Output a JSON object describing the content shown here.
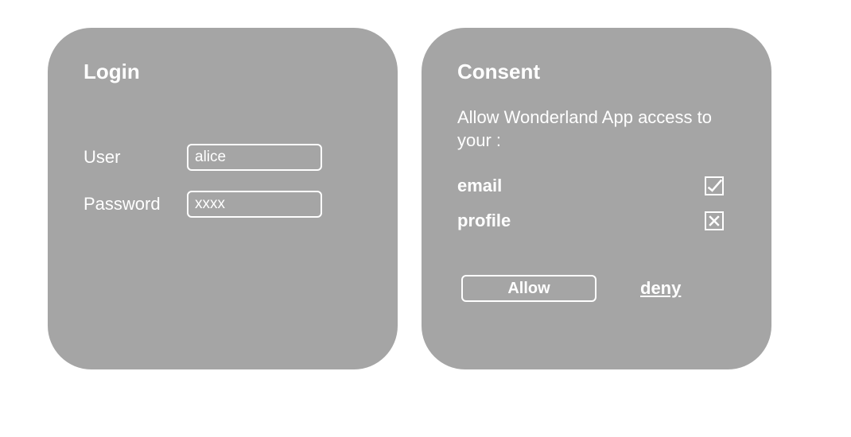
{
  "login": {
    "title": "Login",
    "user_label": "User",
    "user_value": "alice",
    "password_label": "Password",
    "password_value": "xxxx"
  },
  "consent": {
    "title": "Consent",
    "prompt": "Allow Wonderland App access to your :",
    "scopes": [
      {
        "label": "email",
        "checked": true
      },
      {
        "label": "profile",
        "checked": false
      }
    ],
    "allow_label": "Allow",
    "deny_label": "deny"
  }
}
